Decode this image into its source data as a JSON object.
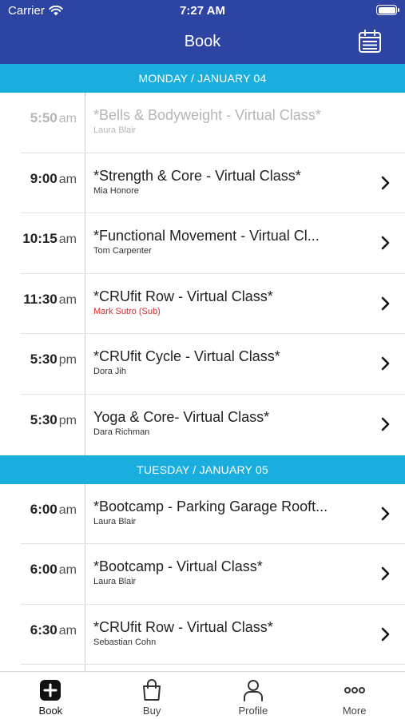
{
  "status": {
    "carrier": "Carrier",
    "time": "7:27 AM"
  },
  "nav": {
    "title": "Book",
    "calendar_icon": "calendar-icon"
  },
  "days": [
    {
      "header": "MONDAY / JANUARY 04",
      "classes": [
        {
          "time": "5:50",
          "ampm": "am",
          "name": "*Bells & Bodyweight - Virtual Class*",
          "instructor": "Laura Blair",
          "disabled": true
        },
        {
          "time": "9:00",
          "ampm": "am",
          "name": "*Strength & Core - Virtual Class*",
          "instructor": "Mia Honore"
        },
        {
          "time": "10:15",
          "ampm": "am",
          "name": "*Functional Movement - Virtual Cl...",
          "instructor": "Tom Carpenter"
        },
        {
          "time": "11:30",
          "ampm": "am",
          "name": "*CRUfit Row - Virtual Class*",
          "instructor": "Mark Sutro (Sub)",
          "sub": true
        },
        {
          "time": "5:30",
          "ampm": "pm",
          "name": "*CRUfit Cycle - Virtual Class*",
          "instructor": "Dora Jih"
        },
        {
          "time": "5:30",
          "ampm": "pm",
          "name": "Yoga & Core- Virtual Class*",
          "instructor": "Dara Richman"
        }
      ]
    },
    {
      "header": "TUESDAY / JANUARY 05",
      "classes": [
        {
          "time": "6:00",
          "ampm": "am",
          "name": "*Bootcamp - Parking Garage Rooft...",
          "instructor": "Laura Blair"
        },
        {
          "time": "6:00",
          "ampm": "am",
          "name": "*Bootcamp - Virtual Class*",
          "instructor": "Laura Blair"
        },
        {
          "time": "6:30",
          "ampm": "am",
          "name": "*CRUfit Row - Virtual Class*",
          "instructor": "Sebastian Cohn"
        },
        {
          "time": "",
          "ampm": "",
          "name": "",
          "instructor": ""
        }
      ]
    }
  ],
  "tabs": [
    {
      "label": "Book",
      "icon": "book-plus-icon",
      "active": true
    },
    {
      "label": "Buy",
      "icon": "shopping-bag-icon"
    },
    {
      "label": "Profile",
      "icon": "profile-icon"
    },
    {
      "label": "More",
      "icon": "more-dots-icon"
    }
  ]
}
